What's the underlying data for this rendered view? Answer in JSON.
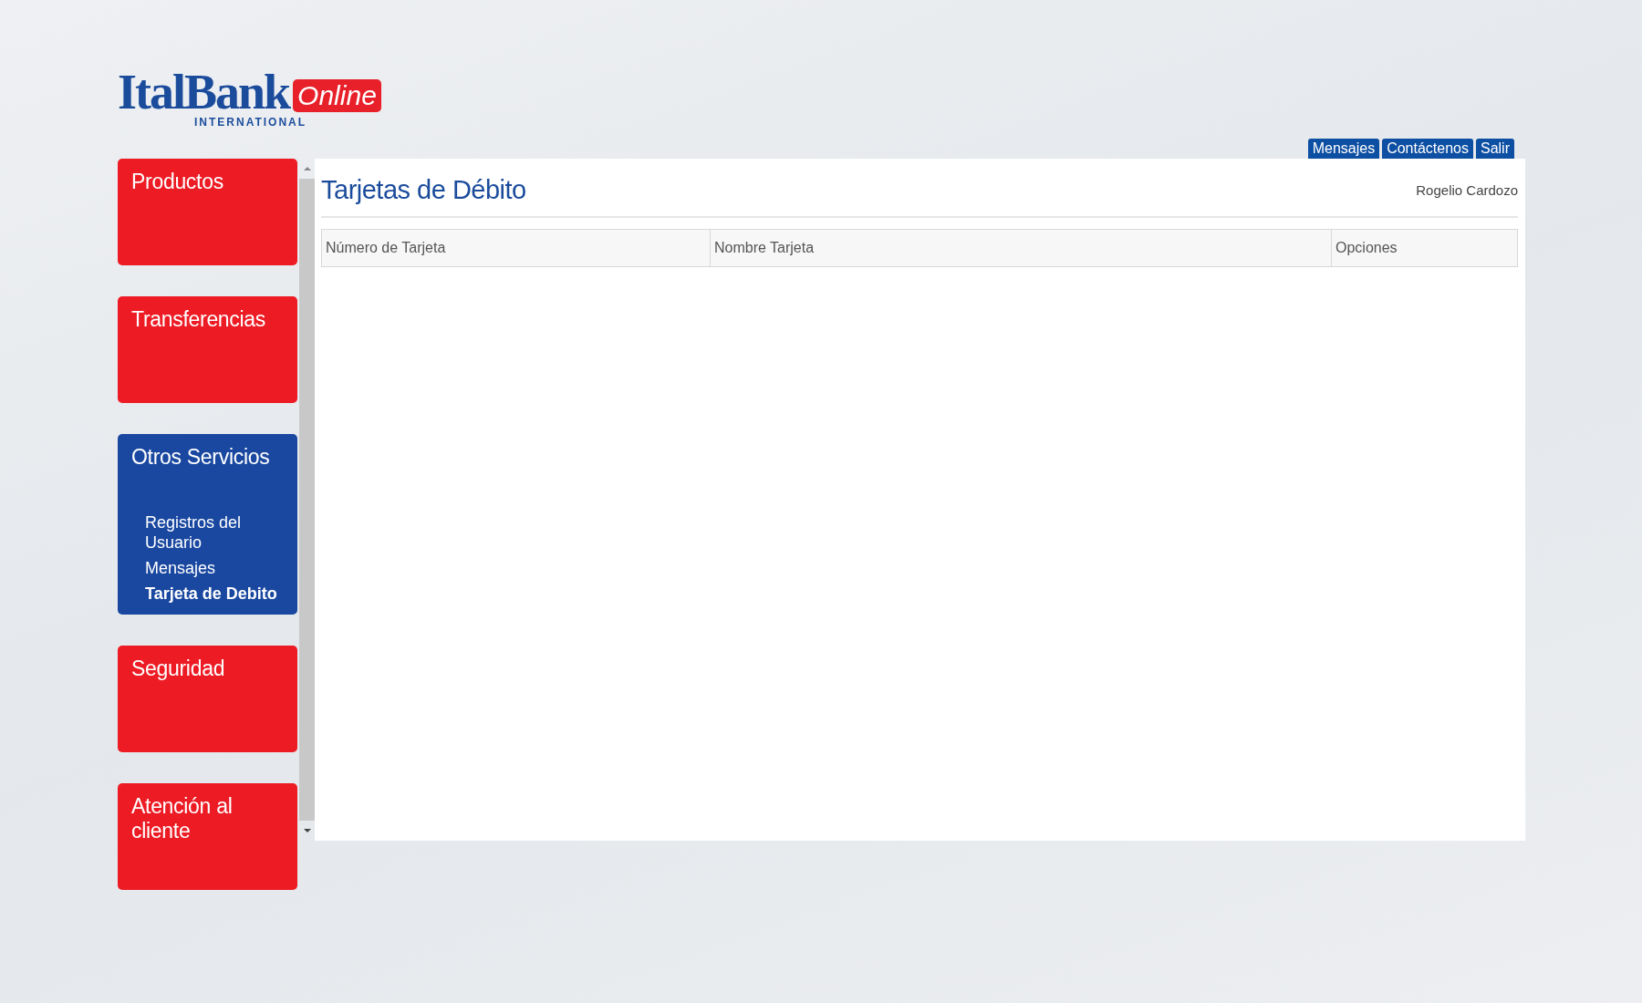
{
  "logo": {
    "name": "ItalBank",
    "badge": "Online",
    "subtitle": "INTERNATIONAL"
  },
  "top_links": [
    "Mensajes",
    "Contáctenos",
    "Salir"
  ],
  "sidebar": {
    "items": [
      {
        "label": "Productos",
        "selected": false
      },
      {
        "label": "Transferencias",
        "selected": false
      },
      {
        "label": "Otros Servicios",
        "selected": true,
        "children": [
          {
            "label": "Registros del Usuario",
            "selected": false
          },
          {
            "label": "Mensajes",
            "selected": false
          },
          {
            "label": "Tarjeta de Debito",
            "selected": true
          }
        ]
      },
      {
        "label": "Seguridad",
        "selected": false
      },
      {
        "label": "Atención al cliente",
        "selected": false
      }
    ]
  },
  "page": {
    "title": "Tarjetas de Débito",
    "user": "Rogelio Cardozo"
  },
  "table": {
    "columns": [
      "Número de Tarjeta",
      "Nombre Tarjeta",
      "Opciones"
    ]
  }
}
